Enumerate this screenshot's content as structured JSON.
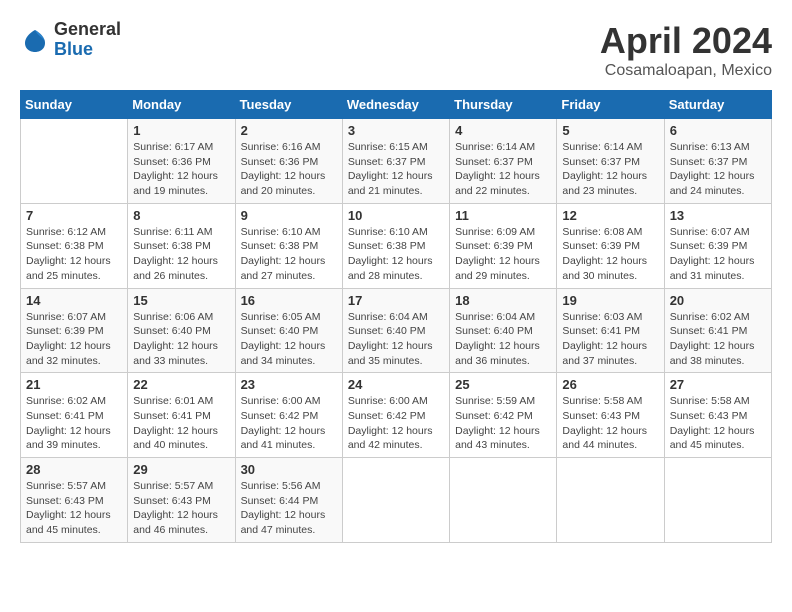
{
  "logo": {
    "general": "General",
    "blue": "Blue"
  },
  "title": "April 2024",
  "subtitle": "Cosamaloapan, Mexico",
  "days_header": [
    "Sunday",
    "Monday",
    "Tuesday",
    "Wednesday",
    "Thursday",
    "Friday",
    "Saturday"
  ],
  "weeks": [
    [
      {
        "day": "",
        "info": ""
      },
      {
        "day": "1",
        "info": "Sunrise: 6:17 AM\nSunset: 6:36 PM\nDaylight: 12 hours\nand 19 minutes."
      },
      {
        "day": "2",
        "info": "Sunrise: 6:16 AM\nSunset: 6:36 PM\nDaylight: 12 hours\nand 20 minutes."
      },
      {
        "day": "3",
        "info": "Sunrise: 6:15 AM\nSunset: 6:37 PM\nDaylight: 12 hours\nand 21 minutes."
      },
      {
        "day": "4",
        "info": "Sunrise: 6:14 AM\nSunset: 6:37 PM\nDaylight: 12 hours\nand 22 minutes."
      },
      {
        "day": "5",
        "info": "Sunrise: 6:14 AM\nSunset: 6:37 PM\nDaylight: 12 hours\nand 23 minutes."
      },
      {
        "day": "6",
        "info": "Sunrise: 6:13 AM\nSunset: 6:37 PM\nDaylight: 12 hours\nand 24 minutes."
      }
    ],
    [
      {
        "day": "7",
        "info": "Sunrise: 6:12 AM\nSunset: 6:38 PM\nDaylight: 12 hours\nand 25 minutes."
      },
      {
        "day": "8",
        "info": "Sunrise: 6:11 AM\nSunset: 6:38 PM\nDaylight: 12 hours\nand 26 minutes."
      },
      {
        "day": "9",
        "info": "Sunrise: 6:10 AM\nSunset: 6:38 PM\nDaylight: 12 hours\nand 27 minutes."
      },
      {
        "day": "10",
        "info": "Sunrise: 6:10 AM\nSunset: 6:38 PM\nDaylight: 12 hours\nand 28 minutes."
      },
      {
        "day": "11",
        "info": "Sunrise: 6:09 AM\nSunset: 6:39 PM\nDaylight: 12 hours\nand 29 minutes."
      },
      {
        "day": "12",
        "info": "Sunrise: 6:08 AM\nSunset: 6:39 PM\nDaylight: 12 hours\nand 30 minutes."
      },
      {
        "day": "13",
        "info": "Sunrise: 6:07 AM\nSunset: 6:39 PM\nDaylight: 12 hours\nand 31 minutes."
      }
    ],
    [
      {
        "day": "14",
        "info": "Sunrise: 6:07 AM\nSunset: 6:39 PM\nDaylight: 12 hours\nand 32 minutes."
      },
      {
        "day": "15",
        "info": "Sunrise: 6:06 AM\nSunset: 6:40 PM\nDaylight: 12 hours\nand 33 minutes."
      },
      {
        "day": "16",
        "info": "Sunrise: 6:05 AM\nSunset: 6:40 PM\nDaylight: 12 hours\nand 34 minutes."
      },
      {
        "day": "17",
        "info": "Sunrise: 6:04 AM\nSunset: 6:40 PM\nDaylight: 12 hours\nand 35 minutes."
      },
      {
        "day": "18",
        "info": "Sunrise: 6:04 AM\nSunset: 6:40 PM\nDaylight: 12 hours\nand 36 minutes."
      },
      {
        "day": "19",
        "info": "Sunrise: 6:03 AM\nSunset: 6:41 PM\nDaylight: 12 hours\nand 37 minutes."
      },
      {
        "day": "20",
        "info": "Sunrise: 6:02 AM\nSunset: 6:41 PM\nDaylight: 12 hours\nand 38 minutes."
      }
    ],
    [
      {
        "day": "21",
        "info": "Sunrise: 6:02 AM\nSunset: 6:41 PM\nDaylight: 12 hours\nand 39 minutes."
      },
      {
        "day": "22",
        "info": "Sunrise: 6:01 AM\nSunset: 6:41 PM\nDaylight: 12 hours\nand 40 minutes."
      },
      {
        "day": "23",
        "info": "Sunrise: 6:00 AM\nSunset: 6:42 PM\nDaylight: 12 hours\nand 41 minutes."
      },
      {
        "day": "24",
        "info": "Sunrise: 6:00 AM\nSunset: 6:42 PM\nDaylight: 12 hours\nand 42 minutes."
      },
      {
        "day": "25",
        "info": "Sunrise: 5:59 AM\nSunset: 6:42 PM\nDaylight: 12 hours\nand 43 minutes."
      },
      {
        "day": "26",
        "info": "Sunrise: 5:58 AM\nSunset: 6:43 PM\nDaylight: 12 hours\nand 44 minutes."
      },
      {
        "day": "27",
        "info": "Sunrise: 5:58 AM\nSunset: 6:43 PM\nDaylight: 12 hours\nand 45 minutes."
      }
    ],
    [
      {
        "day": "28",
        "info": "Sunrise: 5:57 AM\nSunset: 6:43 PM\nDaylight: 12 hours\nand 45 minutes."
      },
      {
        "day": "29",
        "info": "Sunrise: 5:57 AM\nSunset: 6:43 PM\nDaylight: 12 hours\nand 46 minutes."
      },
      {
        "day": "30",
        "info": "Sunrise: 5:56 AM\nSunset: 6:44 PM\nDaylight: 12 hours\nand 47 minutes."
      },
      {
        "day": "",
        "info": ""
      },
      {
        "day": "",
        "info": ""
      },
      {
        "day": "",
        "info": ""
      },
      {
        "day": "",
        "info": ""
      }
    ]
  ]
}
